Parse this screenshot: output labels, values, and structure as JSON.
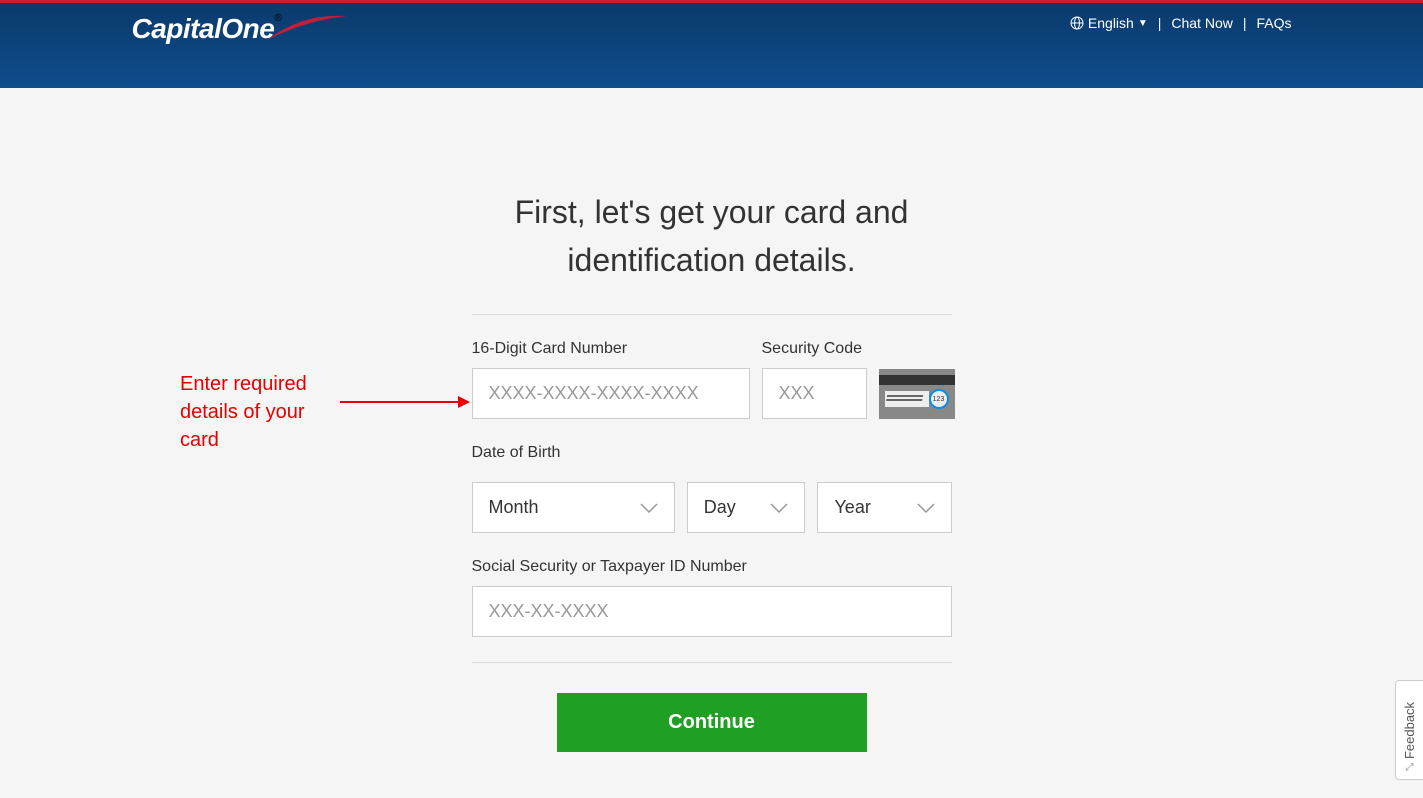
{
  "header": {
    "brand_name": "CapitalOne",
    "language_label": "English",
    "chat_label": "Chat Now",
    "faqs_label": "FAQs"
  },
  "page": {
    "title": "First, let's get your card and identification details."
  },
  "form": {
    "card_number_label": "16-Digit Card Number",
    "card_number_placeholder": "XXXX-XXXX-XXXX-XXXX",
    "cvv_label": "Security Code",
    "cvv_placeholder": "XXX",
    "cvv_hint_digits": "123",
    "dob_label": "Date of Birth",
    "month_label": "Month",
    "day_label": "Day",
    "year_label": "Year",
    "ssn_label": "Social Security or Taxpayer ID Number",
    "ssn_placeholder": "XXX-XX-XXXX",
    "continue_label": "Continue"
  },
  "annotation": {
    "text": "Enter required details of your card"
  },
  "feedback": {
    "label": "Feedback"
  }
}
